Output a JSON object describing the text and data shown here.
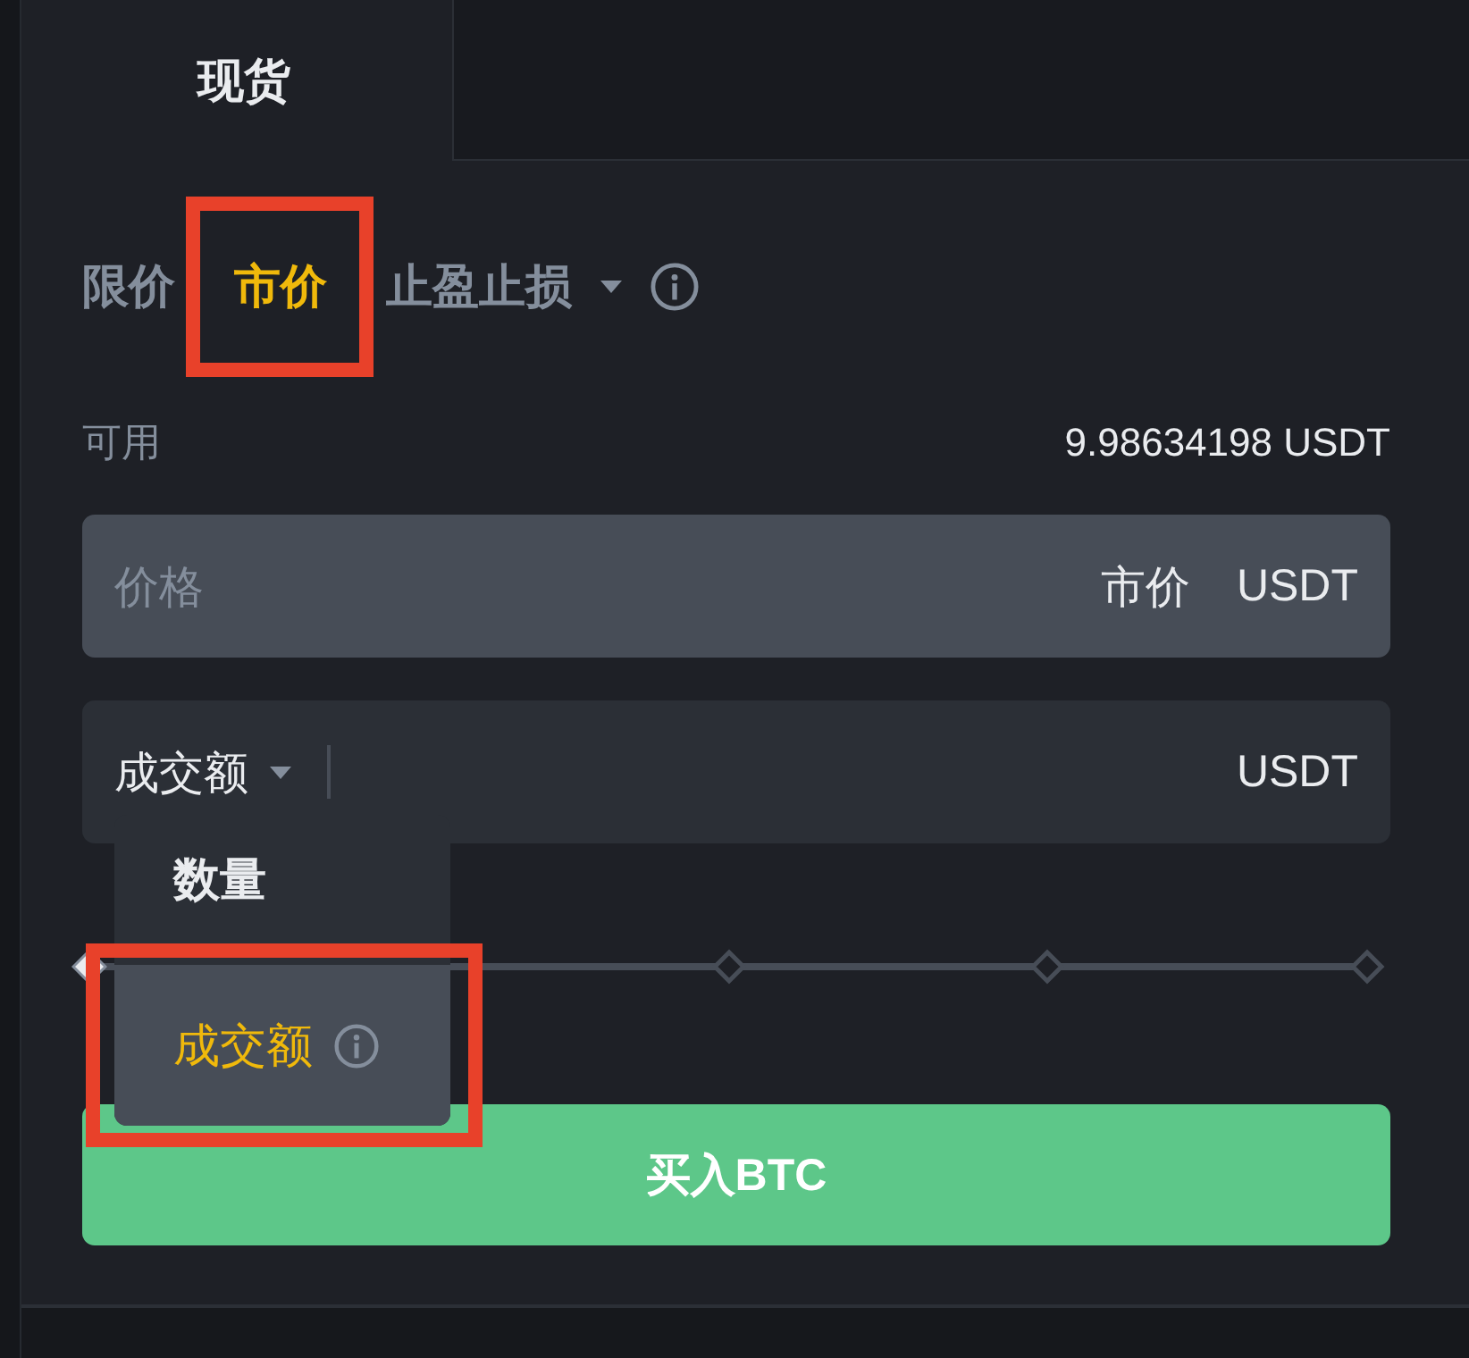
{
  "tabs": [
    {
      "label": "现货",
      "selected": true
    }
  ],
  "order_types": [
    {
      "kind": "plain",
      "label": "限价",
      "selected": false,
      "highlighted": false
    },
    {
      "kind": "plain",
      "label": "市价",
      "selected": true,
      "highlighted": true
    },
    {
      "kind": "dropdown",
      "label": "止盈止损",
      "selected": false,
      "highlighted": false
    }
  ],
  "available": {
    "label": "可用",
    "value": "9.98634198 USDT"
  },
  "price_field": {
    "placeholder": "价格",
    "mode": "市价",
    "unit": "USDT"
  },
  "amount_field": {
    "selector": "成交额",
    "expanded": true,
    "unit": "USDT",
    "menu": [
      {
        "label": "数量",
        "selected": false,
        "highlighted": false,
        "info": false
      },
      {
        "label": "成交额",
        "selected": true,
        "highlighted": true,
        "info": true
      }
    ]
  },
  "slider": {
    "level": 0
  },
  "buy_button": {
    "label": "买入BTC"
  }
}
